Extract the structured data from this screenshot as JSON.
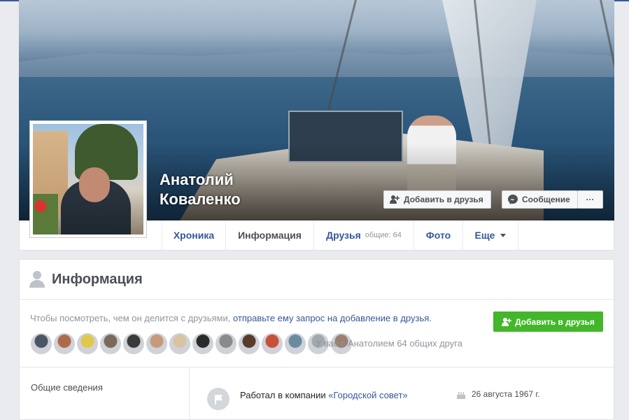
{
  "profile": {
    "name_line1": "Анатолий",
    "name_line2": "Коваленко"
  },
  "cover_buttons": {
    "add_friend": "Добавить в друзья",
    "message": "Сообщение",
    "more": "···"
  },
  "tabs": {
    "chronicle": "Хроника",
    "info": "Информация",
    "friends": "Друзья",
    "friends_sub": "общие: 64",
    "photos": "Фото",
    "more": "Еще"
  },
  "info_card": {
    "title": "Информация",
    "request_text": "Чтобы посмотреть, чем он делится с друзьями,",
    "request_link": "отправьте ему запрос на добавление в друзья.",
    "add_friend_button": "Добавить в друзья",
    "mutual_text": "У вас с Анатолием 64 общих друга",
    "left_item": "Общие сведения",
    "work_prefix": "Работал в компании",
    "work_company": "«Городской совет»",
    "birthday": "26 августа 1967 г."
  },
  "colors": {
    "link": "#365899",
    "green": "#42b72a",
    "background": "#e9ebee"
  },
  "friend_avatars": [
    "#4a5666",
    "#b06a4a",
    "#e0c84a",
    "#7a6a5a",
    "#3a3a3a",
    "#c79a7a",
    "#d9c3a0",
    "#2a2a2a",
    "#8a8a8a",
    "#5a3a2a",
    "#c8503a",
    "#6a8aa0",
    "#a0a8b0",
    "#9a8070"
  ]
}
